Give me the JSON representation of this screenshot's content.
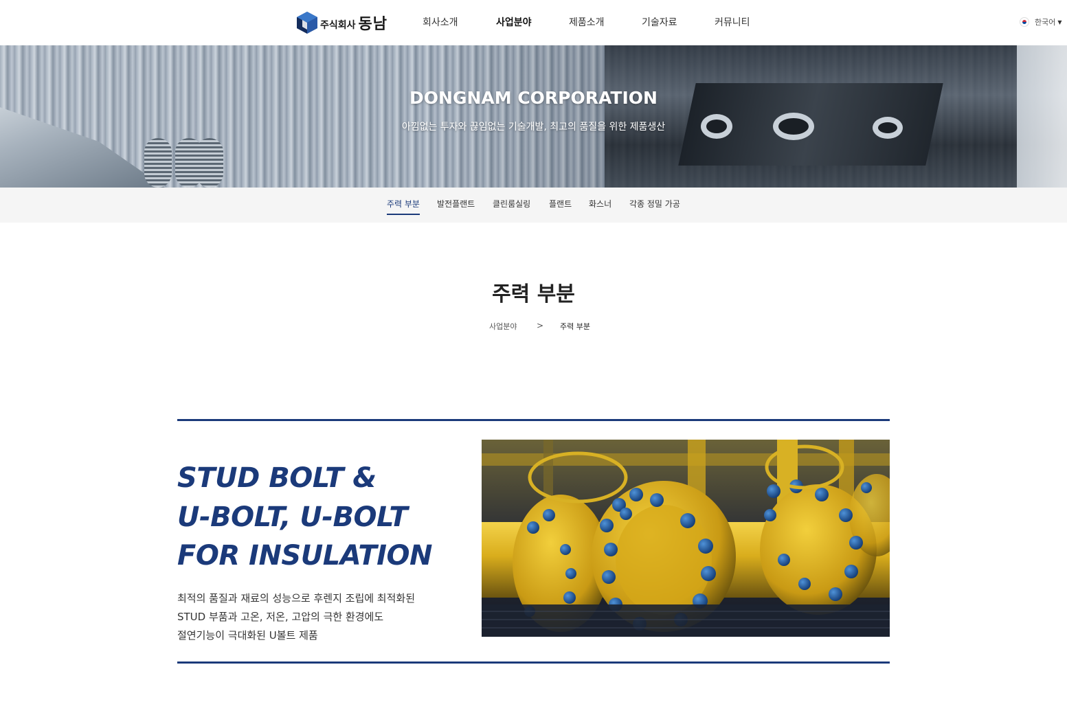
{
  "header": {
    "logo": {
      "small": "주식회사",
      "big": "동남"
    },
    "nav": [
      {
        "label": "회사소개",
        "active": false
      },
      {
        "label": "사업분야",
        "active": true
      },
      {
        "label": "제품소개",
        "active": false
      },
      {
        "label": "기술자료",
        "active": false
      },
      {
        "label": "커뮤니티",
        "active": false
      }
    ],
    "language": {
      "label": "한국어",
      "flag_icon": "korea-flag-icon",
      "caret_icon": "caret-down-icon"
    }
  },
  "hero": {
    "title": "DONGNAM CORPORATION",
    "subtitle": "아낌없는 투자와 끊임없는 기술개발, 최고의 품질을 위한 제품생산"
  },
  "subnav": {
    "items": [
      {
        "label": "주력 부분",
        "active": true
      },
      {
        "label": "발전플랜트",
        "active": false
      },
      {
        "label": "클린룸실링",
        "active": false
      },
      {
        "label": "플랜트",
        "active": false
      },
      {
        "label": "화스너",
        "active": false
      },
      {
        "label": "각종 정밀 가공",
        "active": false
      }
    ]
  },
  "page": {
    "title": "주력 부분",
    "breadcrumb": {
      "parent": "사업분야",
      "separator": ">",
      "current": "주력 부분"
    }
  },
  "feature": {
    "title_lines": [
      "STUD BOLT &",
      "U-BOLT, U-BOLT",
      "FOR INSULATION"
    ],
    "desc_lines": [
      "최적의 품질과 재료의 성능으로 후렌지 조립에 최적화된",
      "STUD 부품과 고온, 저온, 고압의 극한 환경에도",
      "절연기능이 극대화된 U볼트 제품"
    ]
  },
  "colors": {
    "accent": "#1b3a7a",
    "subnav_bg": "#f5f5f5",
    "pipe_yellow": "#e0b81f",
    "bolt_blue": "#1f5fa8"
  }
}
